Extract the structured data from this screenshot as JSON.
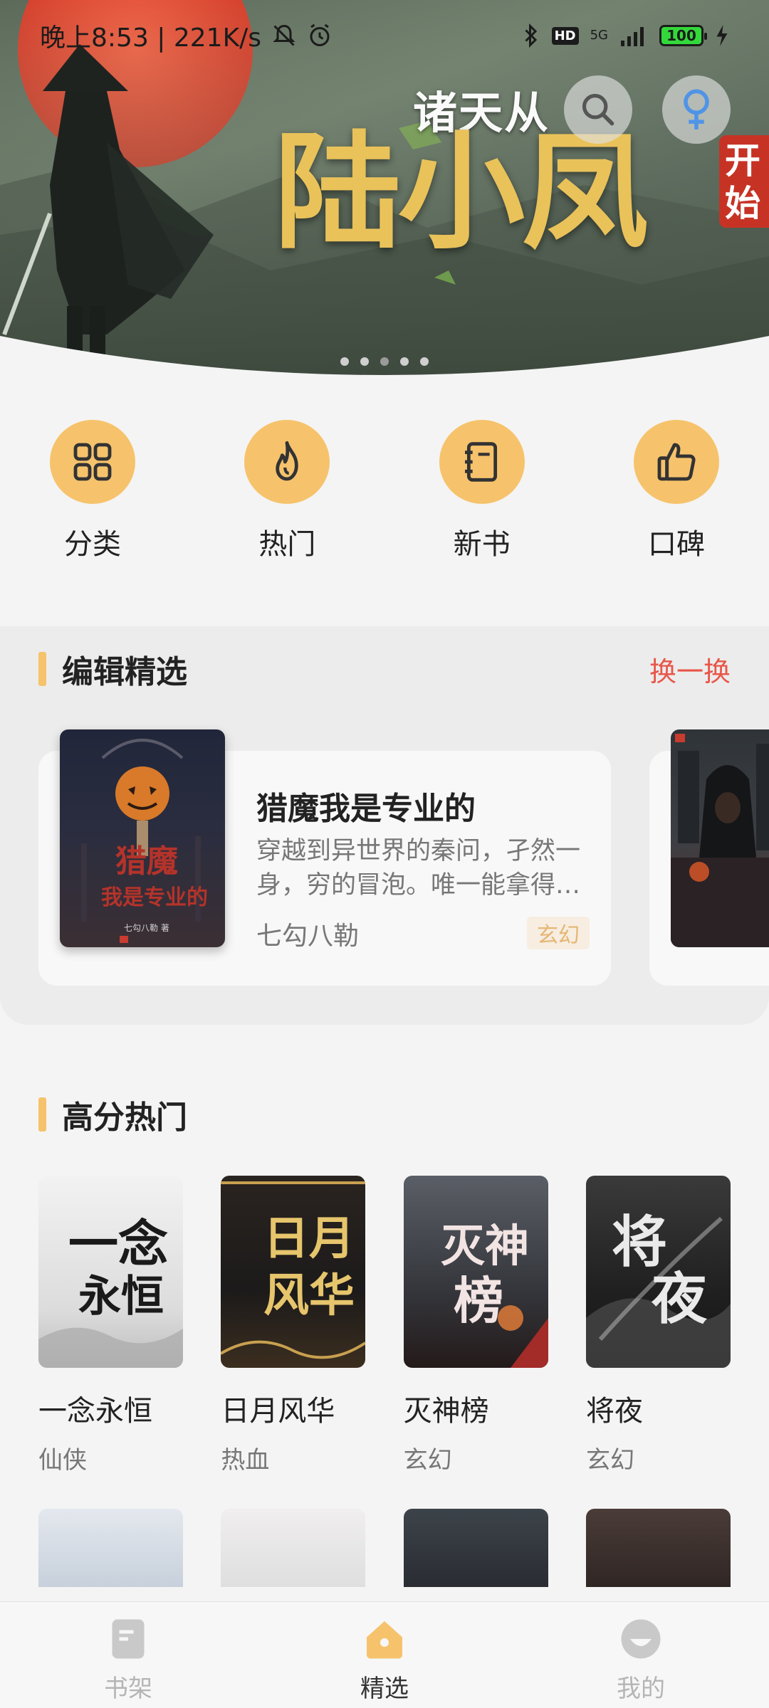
{
  "status_bar": {
    "time_speed": "晚上8:53 | 221K/s",
    "network": "5G",
    "hd": "HD",
    "battery": "100"
  },
  "banner": {
    "title_small": "诸天从",
    "title_big": "陆小凤",
    "tag": "开始",
    "active_dot": 2,
    "dot_count": 5
  },
  "quick_nav": [
    {
      "label": "分类",
      "icon": "grid-icon"
    },
    {
      "label": "热门",
      "icon": "flame-icon"
    },
    {
      "label": "新书",
      "icon": "notebook-icon"
    },
    {
      "label": "口碑",
      "icon": "thumbs-up-icon"
    }
  ],
  "editor_picks": {
    "title": "编辑精选",
    "swap_label": "换一换",
    "book": {
      "title": "猎魔我是专业的",
      "description": "穿越到异世界的秦问，孑然一身，穷的冒泡。唯一能拿得…",
      "author": "七勾八勒",
      "genre": "玄幻"
    }
  },
  "top_rated": {
    "title": "高分热门",
    "books": [
      {
        "title": "一念永恒",
        "genre": "仙侠"
      },
      {
        "title": "日月风华",
        "genre": "热血"
      },
      {
        "title": "灭神榜",
        "genre": "玄幻"
      },
      {
        "title": "将夜",
        "genre": "玄幻"
      }
    ]
  },
  "bottom_nav": [
    {
      "label": "书架",
      "icon": "bookshelf-icon"
    },
    {
      "label": "精选",
      "icon": "home-icon"
    },
    {
      "label": "我的",
      "icon": "profile-icon"
    }
  ],
  "colors": {
    "accent": "#f6c36c",
    "swap_link": "#e8564a",
    "background": "#f4f4f4"
  }
}
